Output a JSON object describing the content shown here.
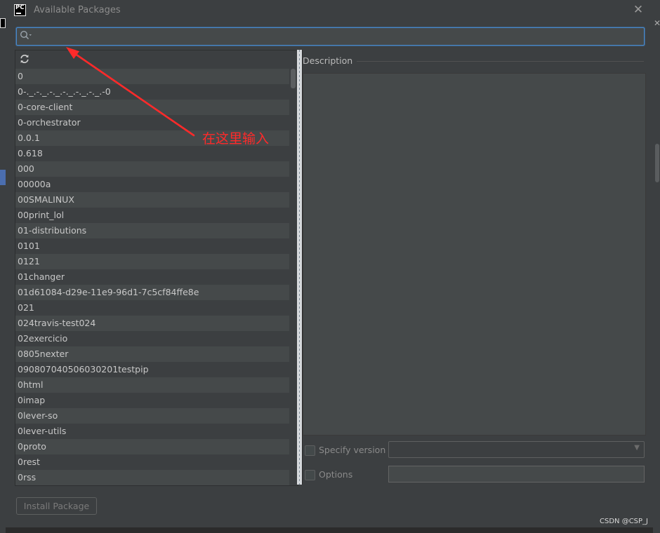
{
  "window": {
    "title": "Available Packages",
    "close_icon": "close-icon",
    "app_icon_text": "PC"
  },
  "search": {
    "value": "",
    "placeholder": ""
  },
  "packages": [
    "0",
    "0-._.-._.-._.-._.-._.-._.-0",
    "0-core-client",
    "0-orchestrator",
    "0.0.1",
    "0.618",
    "000",
    "00000a",
    "00SMALINUX",
    "00print_lol",
    "01-distributions",
    "0101",
    "0121",
    "01changer",
    "01d61084-d29e-11e9-96d1-7c5cf84ffe8e",
    "021",
    "024travis-test024",
    "02exercicio",
    "0805nexter",
    "090807040506030201testpip",
    "0html",
    "0imap",
    "0lever-so",
    "0lever-utils",
    "0proto",
    "0rest",
    "0rss"
  ],
  "description": {
    "label": "Description",
    "text": ""
  },
  "specify_version": {
    "label": "Specify version",
    "checked": false,
    "selected": ""
  },
  "options": {
    "label": "Options",
    "checked": false,
    "value": ""
  },
  "install_button": {
    "label": "Install Package",
    "enabled": false
  },
  "annotation": {
    "text": "在这里输入",
    "color": "#ff2a2a"
  },
  "watermark": "CSDN @CSP_J",
  "colors": {
    "accent": "#4a88c7",
    "dialog_bg": "#3c3f41",
    "row_alt": "#45494a"
  }
}
